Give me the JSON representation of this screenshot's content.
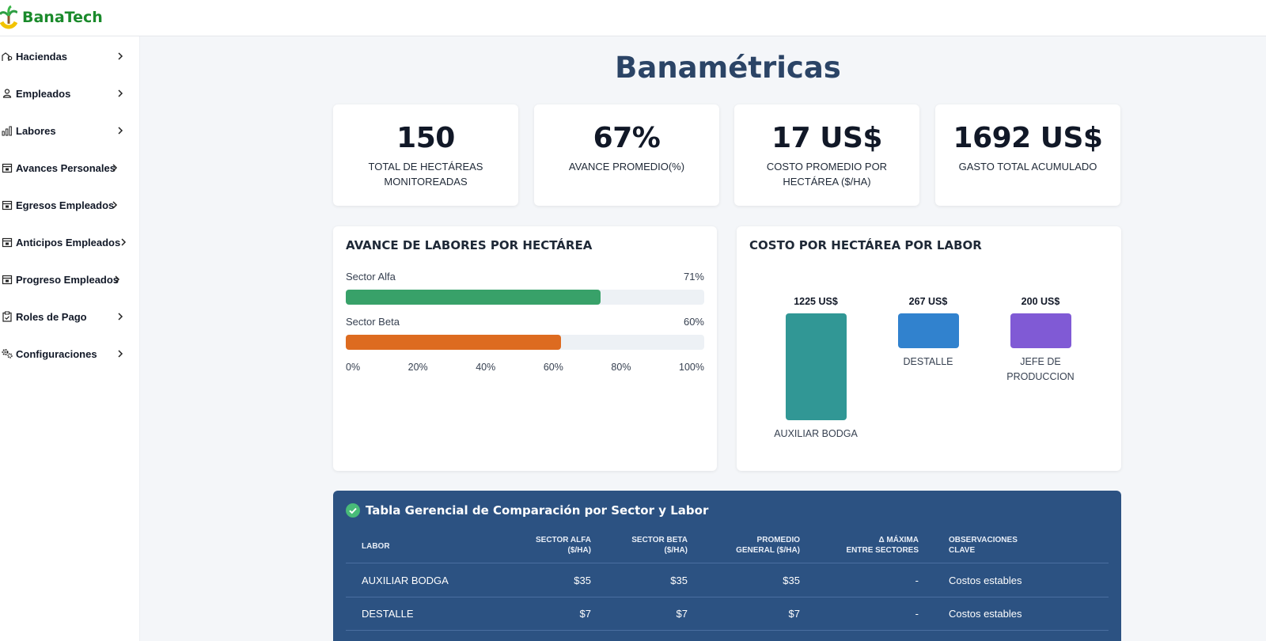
{
  "brand": {
    "name": "BanaTech"
  },
  "sidebar": {
    "items": [
      {
        "label": "Haciendas",
        "icon": "farm-icon"
      },
      {
        "label": "Empleados",
        "icon": "user-icon"
      },
      {
        "label": "Labores",
        "icon": "bar-chart-icon"
      },
      {
        "label": "Avances Personales",
        "icon": "calendar-icon"
      },
      {
        "label": "Egresos Empleados",
        "icon": "calendar-icon"
      },
      {
        "label": "Anticipos Empleados",
        "icon": "calendar-icon"
      },
      {
        "label": "Progreso Empleados",
        "icon": "calendar-icon"
      },
      {
        "label": "Roles de Pago",
        "icon": "clipboard-icon"
      },
      {
        "label": "Configuraciones",
        "icon": "gears-icon"
      }
    ]
  },
  "page": {
    "title": "Banamétricas"
  },
  "kpis": [
    {
      "value": "150",
      "label": "Total de Hectáreas Monitoreadas"
    },
    {
      "value": "67%",
      "label": "Avance Promedio(%)"
    },
    {
      "value": "17 US$",
      "label": "Costo Promedio por Hectárea ($/Ha)"
    },
    {
      "value": "1692 US$",
      "label": "Gasto Total Acumulado"
    }
  ],
  "progress_card": {
    "title": "AVANCE DE LABORES POR HECTÁREA",
    "ticks": [
      "0%",
      "20%",
      "40%",
      "60%",
      "80%",
      "100%"
    ]
  },
  "cost_card": {
    "title": "COSTO POR HECTÁREA POR LABOR"
  },
  "chart_data": [
    {
      "type": "bar",
      "orientation": "horizontal",
      "title": "AVANCE DE LABORES POR HECTÁREA",
      "categories": [
        "Sector Alfa",
        "Sector Beta"
      ],
      "values": [
        71,
        60
      ],
      "value_labels": [
        "71%",
        "60%"
      ],
      "colors": [
        "#38a169",
        "#dd6b20"
      ],
      "xlim": [
        0,
        100
      ],
      "tick_labels": [
        "0%",
        "20%",
        "40%",
        "60%",
        "80%",
        "100%"
      ]
    },
    {
      "type": "bar",
      "title": "COSTO POR HECTÁREA POR LABOR",
      "categories": [
        "Auxiliar Bodga",
        "Destalle",
        "Jefe de Produccion"
      ],
      "values": [
        1225,
        267,
        200
      ],
      "value_labels": [
        "1225 US$",
        "267 US$",
        "200 US$"
      ],
      "colors": [
        "#319795",
        "#3182ce",
        "#805ad5"
      ]
    }
  ],
  "table": {
    "title": "Tabla Gerencial de Comparación por Sector y Labor",
    "headers": {
      "labor": "Labor",
      "alfa_1": "Sector Alfa",
      "alfa_2": "($/Ha)",
      "beta_1": "Sector Beta",
      "beta_2": "($/Ha)",
      "prom_1": "Promedio",
      "prom_2": "General ($/Ha)",
      "delta_1": "Δ Máxima",
      "delta_2": "Entre Sectores",
      "obs_1": "Observaciones",
      "obs_2": "Clave"
    },
    "rows": [
      {
        "labor": "AUXILIAR BODGA",
        "alfa": "$35",
        "beta": "$35",
        "promedio": "$35",
        "delta": "-",
        "obs": "Costos estables"
      },
      {
        "labor": "DESTALLE",
        "alfa": "$7",
        "beta": "$7",
        "promedio": "$7",
        "delta": "-",
        "obs": "Costos estables"
      }
    ]
  }
}
